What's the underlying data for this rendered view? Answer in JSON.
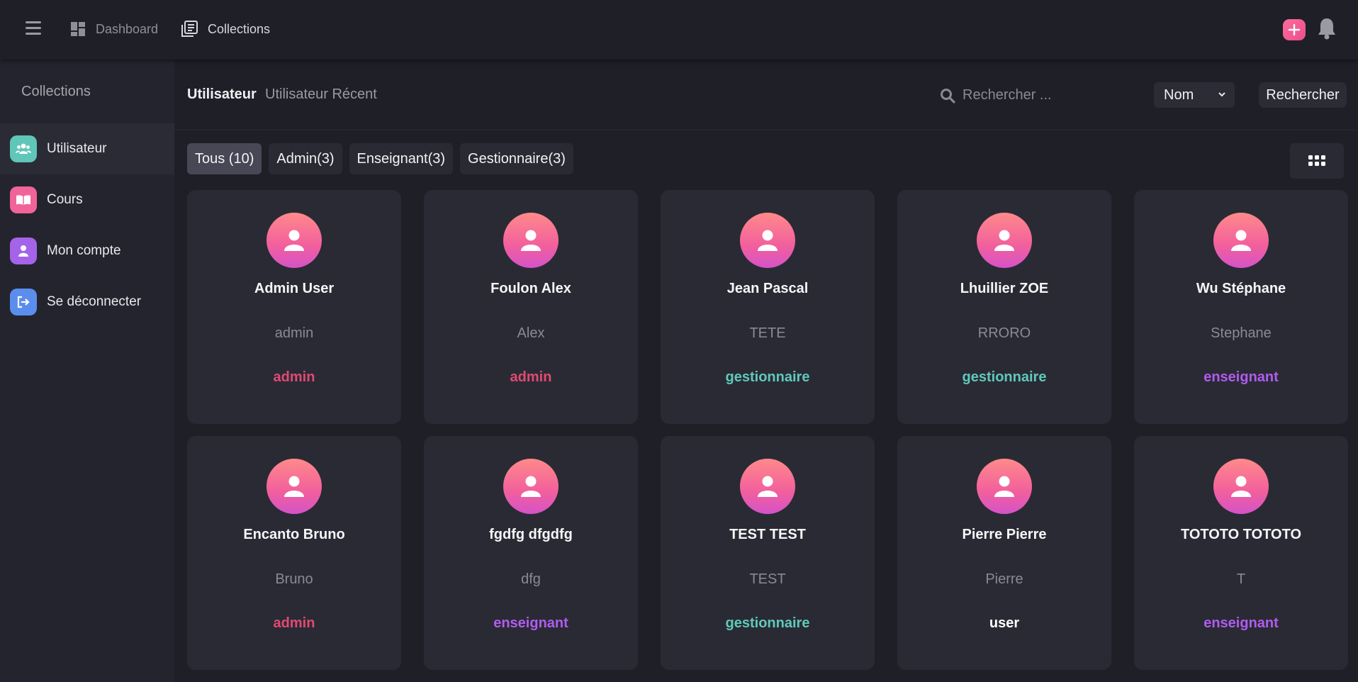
{
  "topbar": {
    "dashboard_label": "Dashboard",
    "collections_label": "Collections",
    "accent_color": "#ec5a95"
  },
  "sidebar": {
    "title": "Collections",
    "items": [
      {
        "label": "Utilisateur",
        "icon": "users-icon",
        "color": "#5fc6b8"
      },
      {
        "label": "Cours",
        "icon": "book-open-icon",
        "color": "#f0649a"
      },
      {
        "label": "Mon compte",
        "icon": "user-icon",
        "color": "#a463e8"
      },
      {
        "label": "Se déconnecter",
        "icon": "sign-out-icon",
        "color": "#5b8ded"
      }
    ]
  },
  "subheader": {
    "tab_users": "Utilisateur",
    "tab_recent": "Utilisateur Récent",
    "search_placeholder": "Rechercher ...",
    "select_value": "Nom",
    "search_button": "Rechercher"
  },
  "filters": [
    {
      "label": "Tous (10)"
    },
    {
      "label": "Admin(3)"
    },
    {
      "label": "Enseignant(3)"
    },
    {
      "label": "Gestionnaire(3)"
    }
  ],
  "role_colors": {
    "admin": "#e04a72",
    "gestionnaire": "#5fc9bb",
    "enseignant": "#b05cf0",
    "user": "#ffffff"
  },
  "users": [
    {
      "name": "Admin User",
      "sub": "admin",
      "role": "admin"
    },
    {
      "name": "Foulon Alex",
      "sub": "Alex",
      "role": "admin"
    },
    {
      "name": "Jean Pascal",
      "sub": "TETE",
      "role": "gestionnaire"
    },
    {
      "name": "Lhuillier ZOE",
      "sub": "RRORO",
      "role": "gestionnaire"
    },
    {
      "name": "Wu Stéphane",
      "sub": "Stephane",
      "role": "enseignant"
    },
    {
      "name": "Encanto Bruno",
      "sub": "Bruno",
      "role": "admin"
    },
    {
      "name": "fgdfg dfgdfg",
      "sub": "dfg",
      "role": "enseignant"
    },
    {
      "name": "TEST TEST",
      "sub": "TEST",
      "role": "gestionnaire"
    },
    {
      "name": "Pierre Pierre",
      "sub": "Pierre",
      "role": "user"
    },
    {
      "name": "TOTOTO TOTOTO",
      "sub": "T",
      "role": "enseignant"
    }
  ]
}
